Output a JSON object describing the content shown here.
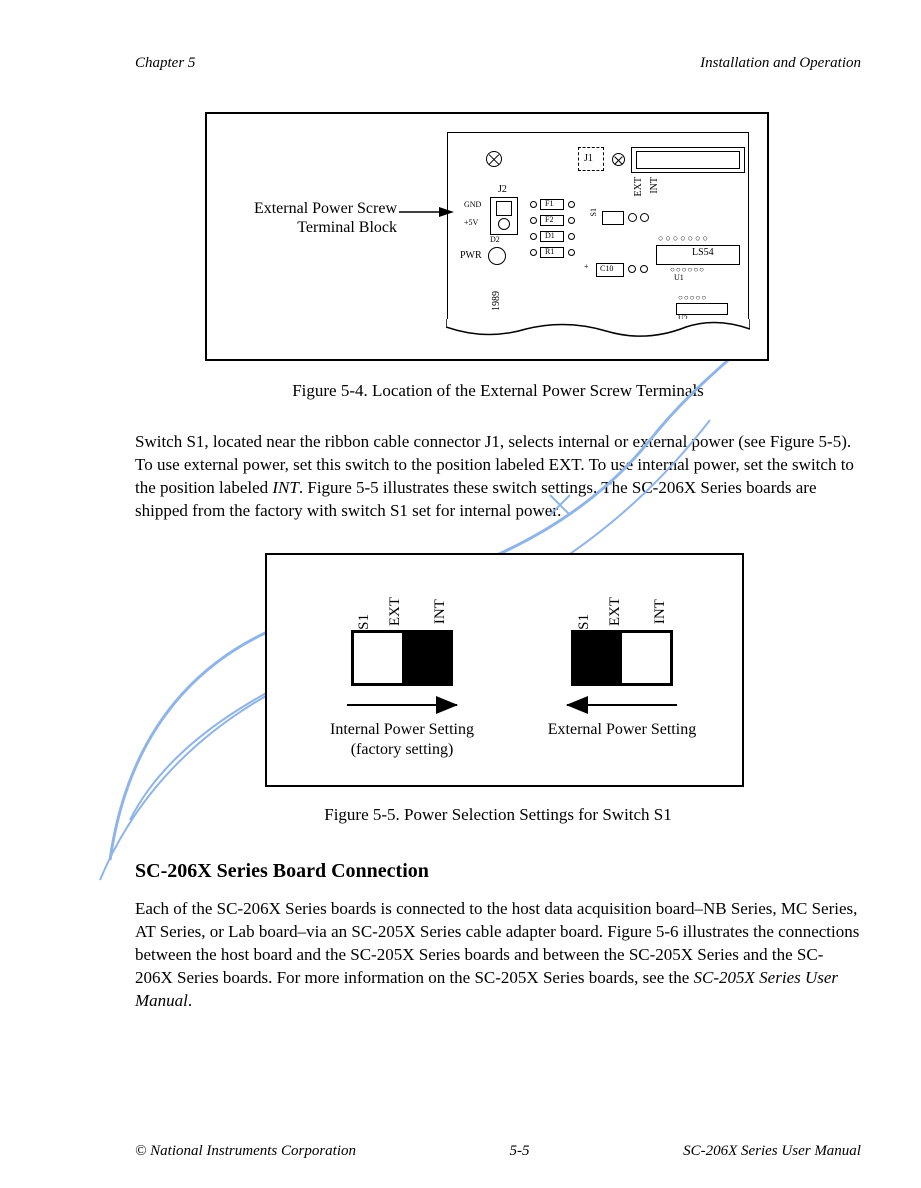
{
  "header": {
    "left": "Chapter 5",
    "right": "Installation and Operation"
  },
  "figure1": {
    "callout_line1": "External Power Screw",
    "callout_line2": "Terminal Block",
    "board_labels": {
      "j1": "J1",
      "j2": "J2",
      "gnd": "GND",
      "plus5v": "+5V",
      "pwr": "PWR",
      "d2": "D2",
      "f1": "F1",
      "f2": "F2",
      "d1": "D1",
      "r1": "R1",
      "c10": "C10",
      "ls54": "LS54",
      "u1": "U1",
      "u2": "U2",
      "s1": "S1",
      "ext": "EXT",
      "int": "INT",
      "year": "1989"
    },
    "caption": "Figure 5-4.  Location of the External Power Screw Terminals"
  },
  "body": {
    "p1_a": "Switch S1, located near the ribbon cable connector J1, selects internal or external power (see Figure 5-5).  To use external power, set this switch to the position labeled EXT.  To use internal power, set the switch to the position labeled ",
    "p1_int": "INT",
    "p1_b": ".  Figure 5-5 illustrates these switch settings.  The SC-206X Series boards are shipped from the factory with switch S1 set for internal power."
  },
  "figure2": {
    "left": {
      "s1": "S1",
      "ext": "EXT",
      "int": "INT",
      "label_line1": "Internal Power Setting",
      "label_line2": "(factory setting)"
    },
    "right": {
      "s1": "S1",
      "ext": "EXT",
      "int": "INT",
      "label_line1": "External Power Setting"
    },
    "caption": "Figure 5-5.  Power Selection Settings for Switch S1"
  },
  "section": {
    "heading": "SC-206X Series Board Connection",
    "p1_a": "Each of the SC-206X Series boards is connected to the host data acquisition board–NB Series, MC Series, AT Series, or Lab board–via an SC-205X Series cable adapter board.  Figure 5-6 illustrates the connections between the host board and the SC-205X Series boards and between the SC-205X Series and the SC-206X Series boards.  For more information on the SC-205X Series boards, see the ",
    "p1_em": "SC-205X Series User Manual",
    "p1_b": "."
  },
  "footer": {
    "left": "© National Instruments Corporation",
    "center": "5-5",
    "right": "SC-206X Series User Manual"
  }
}
